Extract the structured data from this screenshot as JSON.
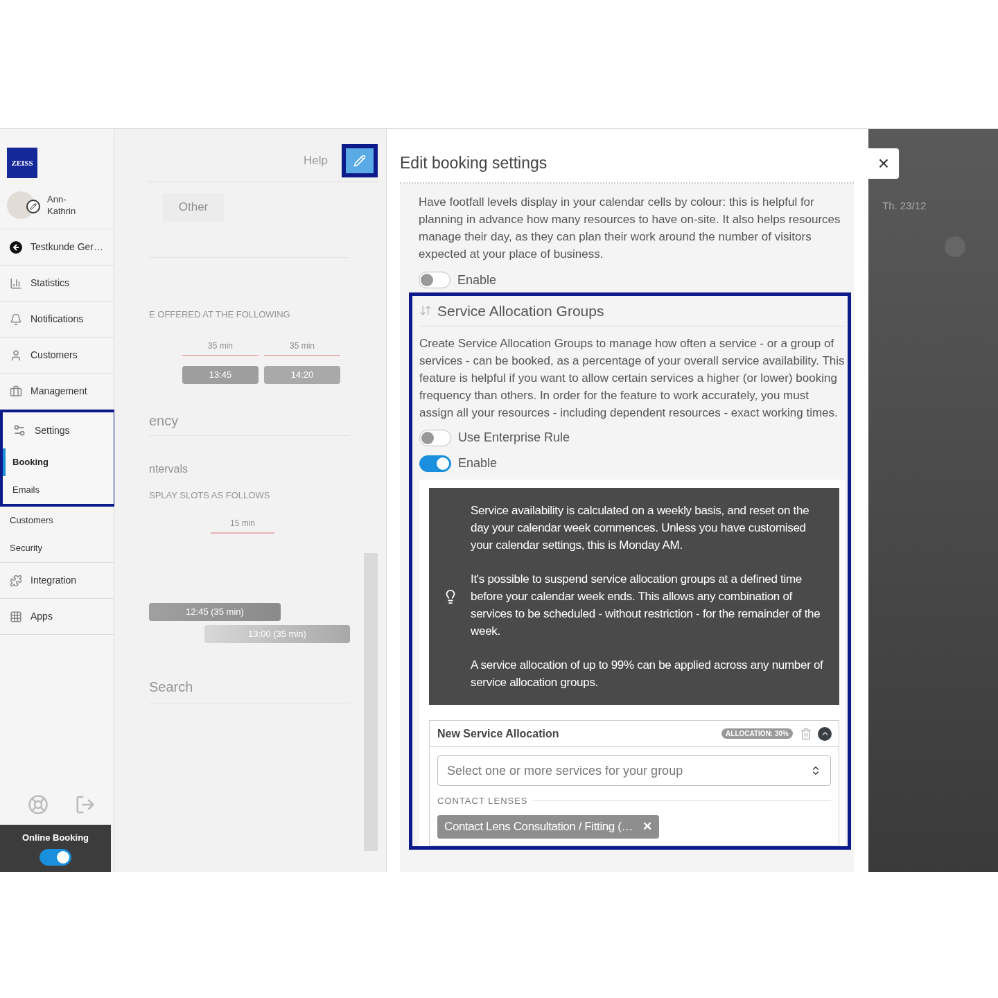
{
  "header": {
    "logo": "ZEISS",
    "user_name": "Ann-\nKathrin"
  },
  "sidebar": {
    "items": [
      {
        "label": "Testkunde Ger…",
        "selected": false
      },
      {
        "label": "Statistics",
        "selected": false
      },
      {
        "label": "Notifications",
        "selected": false
      },
      {
        "label": "Customers",
        "selected": false
      },
      {
        "label": "Management",
        "selected": false
      },
      {
        "label": "Settings",
        "selected": false,
        "highlighted": true,
        "children": [
          {
            "label": "Booking",
            "selected": true
          },
          {
            "label": "Emails",
            "selected": false
          },
          {
            "label": "Customers",
            "selected": false
          },
          {
            "label": "Security",
            "selected": false
          }
        ]
      },
      {
        "label": "Integration",
        "selected": false
      },
      {
        "label": "Apps",
        "selected": false
      }
    ],
    "online_booking": {
      "label": "Online Booking",
      "on": true
    }
  },
  "background_panel": {
    "help_label": "Help",
    "edit_button": {
      "highlighted": true
    },
    "filter_chip": "Other",
    "slots_heading": "E OFFERED AT THE FOLLOWING",
    "slot_durations": [
      "35 min",
      "35 min"
    ],
    "slots": [
      "13:45",
      "14:20"
    ],
    "frequency_heading": "ency",
    "intervals_heading": "ntervals",
    "display_heading": "SPLAY SLOTS AS FOLLOWS",
    "interval_duration": "15 min",
    "bookings": [
      "12:45 (35 min)",
      "13:00 (35 min)"
    ],
    "search_heading": "Search"
  },
  "modal": {
    "title": "Edit booking settings",
    "footfall": {
      "text": "Have footfall levels display in your calendar cells by colour: this is helpful for planning in advance how many resources to have on-site. It also helps resources manage their day, as they can plan their work around the number of visitors expected at your place of business.",
      "toggle": {
        "label": "Enable",
        "on": false
      }
    },
    "allocation_section": {
      "title": "Service Allocation Groups",
      "highlighted": true,
      "text": "Create Service Allocation Groups to manage how often a service - or a group of services - can be booked, as a percentage of your overall service availability. This feature is helpful if you want to allow certain services a higher (or lower) booking frequency than others. In order for the feature to work accurately, you must assign all your resources - including dependent resources - exact working times.",
      "toggles": [
        {
          "label": "Use Enterprise Rule",
          "on": false
        },
        {
          "label": "Enable",
          "on": true
        }
      ],
      "info": [
        "Service availability is calculated on a weekly basis, and reset on the day your calendar week commences. Unless you have customised your calendar settings, this is Monday AM.",
        "It's possible to suspend service allocation groups at a defined time before your calendar week ends. This allows any combination of services to be scheduled - without restriction - for the remainder of the week.",
        "A service allocation of up to 99% can be applied across any number of service allocation groups."
      ],
      "card": {
        "title": "New Service Allocation",
        "badge": "ALLOCATION: 30%",
        "expanded": true,
        "select_placeholder": "Select one or more services for your group",
        "group_label": "CONTACT LENSES",
        "chips": [
          {
            "label": "Contact Lens Consultation / Fitting (…",
            "remove": "✕"
          }
        ]
      }
    }
  },
  "calendar": {
    "close": "×",
    "date": "Th. 23/12"
  }
}
